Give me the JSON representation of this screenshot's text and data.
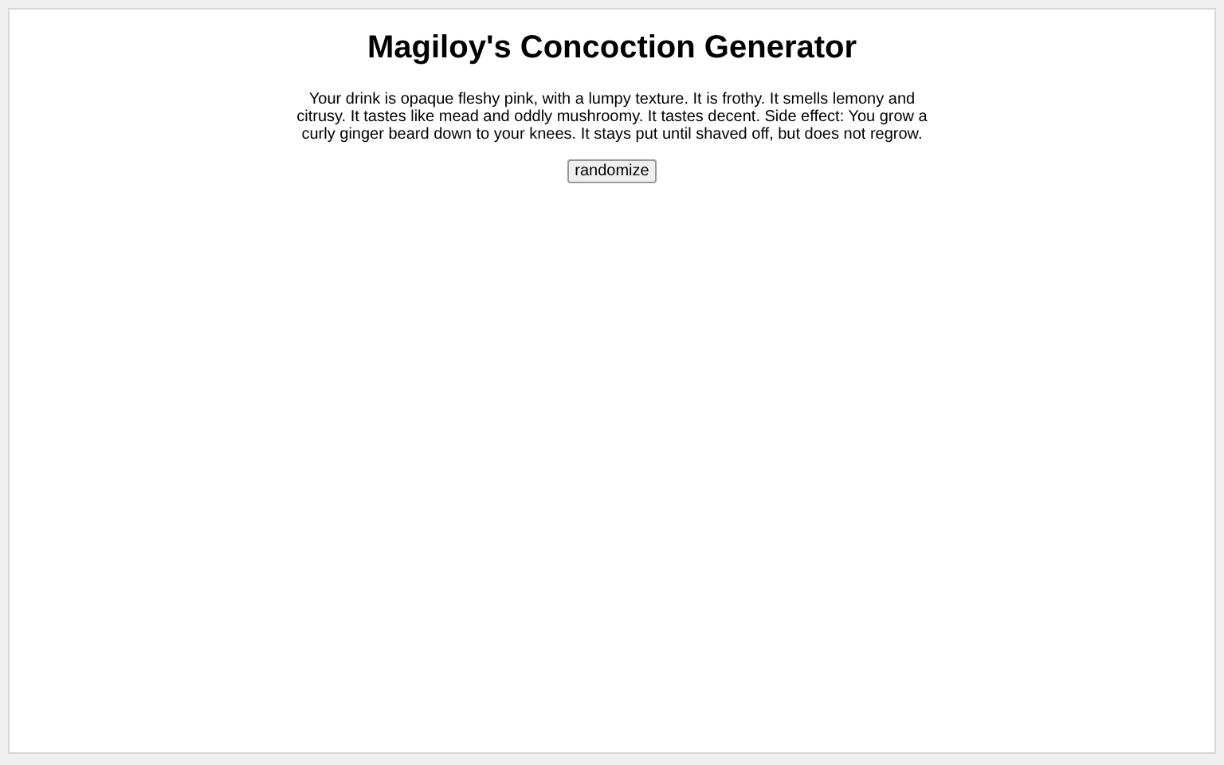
{
  "title": "Magiloy's Concoction Generator",
  "description": "Your drink is opaque fleshy pink, with a lumpy texture. It is frothy. It smells lemony and citrusy. It tastes like mead and oddly mushroomy. It tastes decent. Side effect: You grow a curly ginger beard down to your knees. It stays put until shaved off, but does not regrow.",
  "button": "randomize"
}
